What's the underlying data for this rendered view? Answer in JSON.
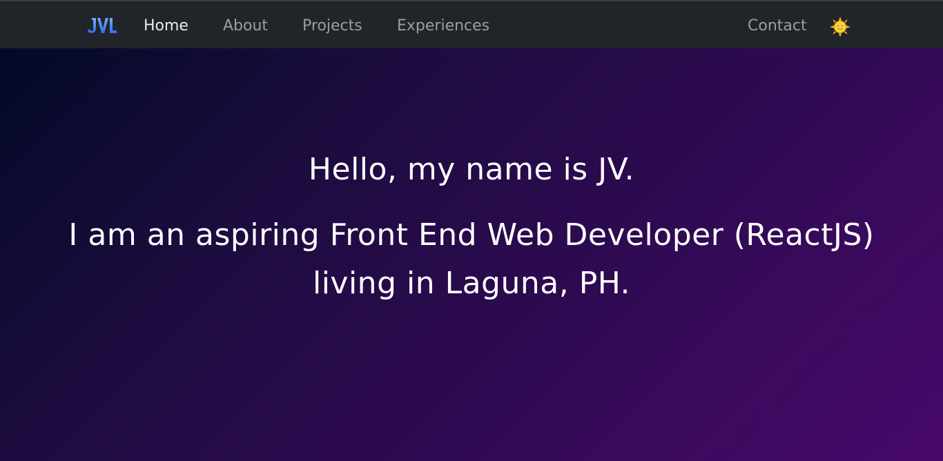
{
  "navbar": {
    "brand": {
      "text": "JVL",
      "icon": "jvl-logo",
      "colors": [
        "#5b8dff",
        "#2f6df0"
      ]
    },
    "links": [
      {
        "label": "Home",
        "active": true
      },
      {
        "label": "About",
        "active": false
      },
      {
        "label": "Projects",
        "active": false
      },
      {
        "label": "Experiences",
        "active": false
      }
    ],
    "contact_label": "Contact",
    "theme_toggle": {
      "icon": "sun-icon",
      "color": "#f6c218"
    }
  },
  "hero": {
    "greeting": "Hello, my name is JV.",
    "intro_line1": "I am an aspiring Front End Web Developer (ReactJS)",
    "intro_line2": "living in Laguna, PH."
  },
  "colors": {
    "navbar_bg": "#212529",
    "link_inactive": "#9a9da1",
    "link_active": "#e9ecef",
    "hero_gradient_start": "#020a26",
    "hero_gradient_end": "#48096b",
    "hero_text": "#ffffff"
  }
}
